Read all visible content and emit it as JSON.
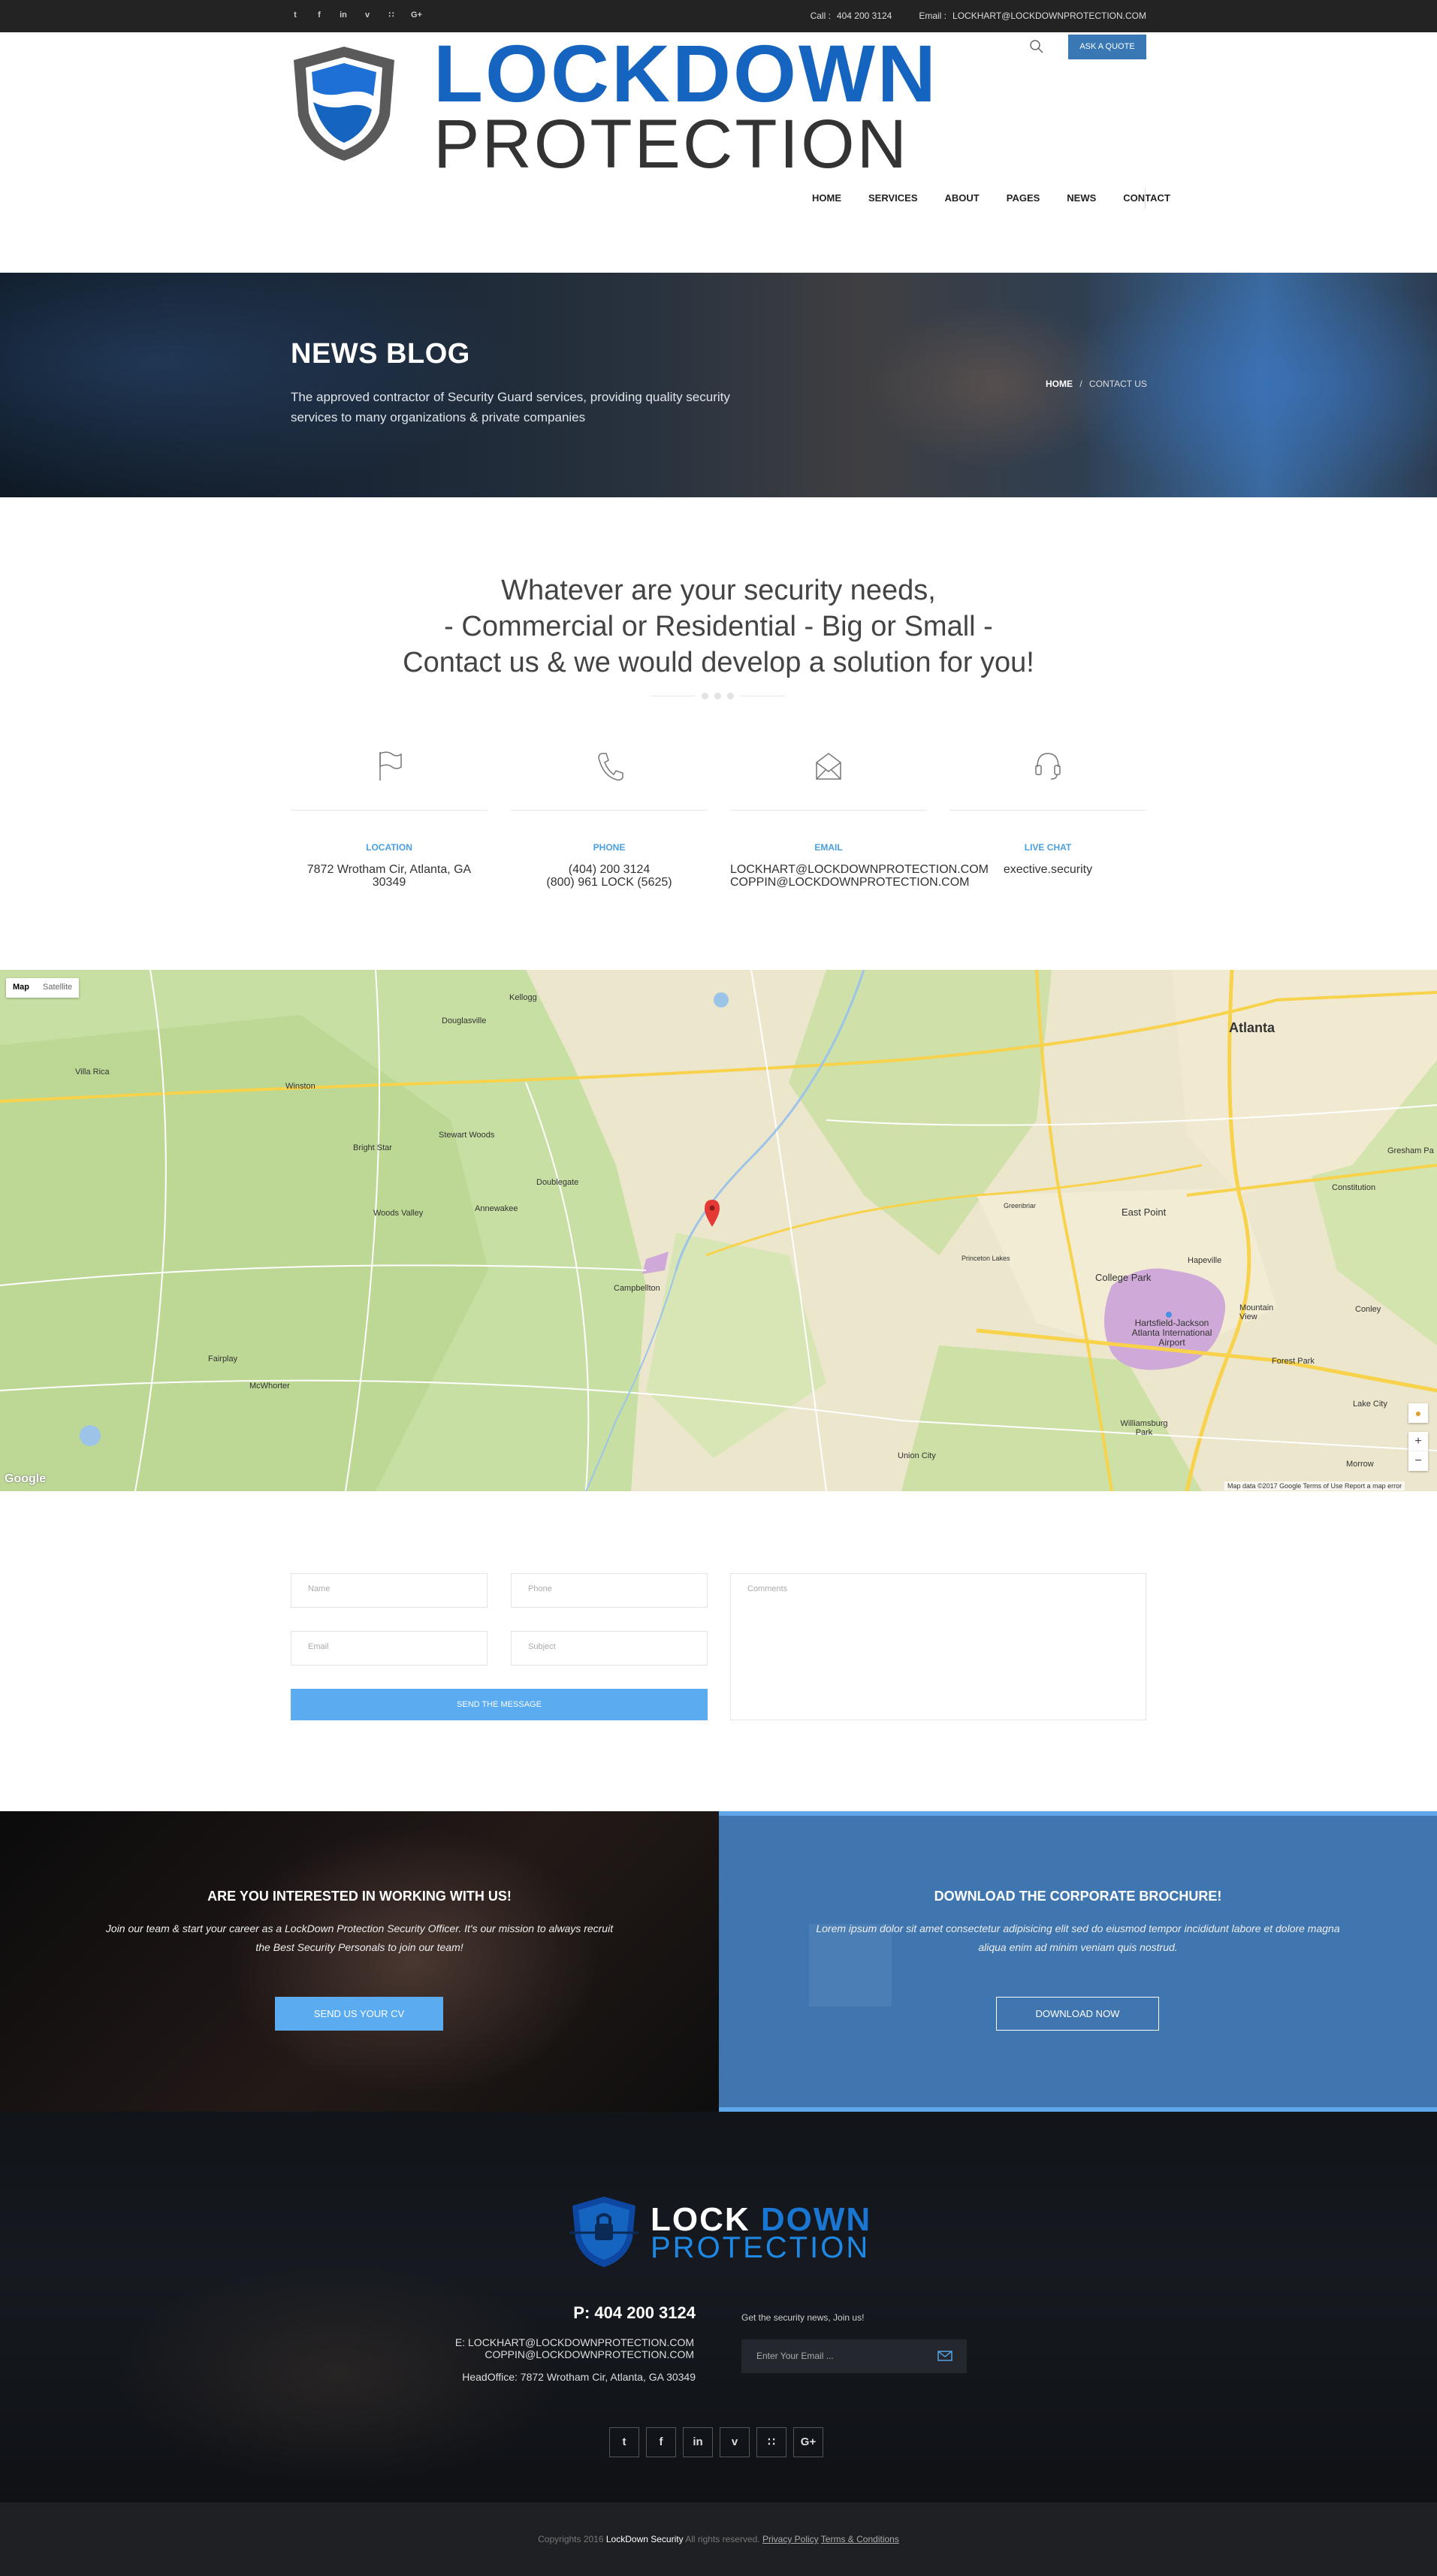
{
  "topbar": {
    "social_icons": [
      {
        "name": "twitter-icon",
        "glyph": "t"
      },
      {
        "name": "facebook-icon",
        "glyph": "f"
      },
      {
        "name": "linkedin-icon",
        "glyph": "in"
      },
      {
        "name": "vimeo-icon",
        "glyph": "v"
      },
      {
        "name": "rss-icon",
        "glyph": "∷"
      },
      {
        "name": "google-plus-icon",
        "glyph": "G+"
      }
    ],
    "call_label": "Call :",
    "call_value": "404 200 3124",
    "email_label": "Email :",
    "email_value": "LOCKHART@LOCKDOWNPROTECTION.COM"
  },
  "header": {
    "logo_line1": "LOCKDOWN",
    "logo_line2": "PROTECTION",
    "quote_button": "ASK A QUOTE",
    "nav": [
      "HOME",
      "SERVICES",
      "ABOUT",
      "PAGES",
      "NEWS",
      "CONTACT"
    ]
  },
  "hero": {
    "title": "NEWS BLOG",
    "subtitle": "The approved contractor of Security Guard services, providing quality security services to many organizations & private companies",
    "breadcrumb_home": "HOME",
    "breadcrumb_sep": "/",
    "breadcrumb_current": "CONTACT US"
  },
  "intro": {
    "line1": "Whatever are your security needs,",
    "line2": "- Commercial or Residential - Big or Small -",
    "line3": "Contact us & we would develop a solution for you!"
  },
  "info": [
    {
      "label": "LOCATION",
      "icon": "flag-icon",
      "lines": [
        "7872 Wrotham Cir, Atlanta, GA",
        "30349"
      ]
    },
    {
      "label": "PHONE",
      "icon": "phone-icon",
      "lines": [
        "(404) 200 3124",
        "(800) 961 LOCK (5625)"
      ]
    },
    {
      "label": "EMAIL",
      "icon": "envelope-icon",
      "lines": [
        "LOCKHART@LOCKDOWNPROTECTION.COM",
        "COPPIN@LOCKDOWNPROTECTION.COM"
      ]
    },
    {
      "label": "LIVE CHAT",
      "icon": "headset-icon",
      "lines": [
        "exective.security"
      ]
    }
  ],
  "map": {
    "btn_map": "Map",
    "btn_satellite": "Satellite",
    "labels": [
      "Atlanta",
      "Douglasville",
      "Kellogg",
      "Villa Rica",
      "Winston",
      "Bright Star",
      "Stewart Woods",
      "Doublegate",
      "Annewakee",
      "Woods Valley",
      "Campbellton",
      "Fairplay",
      "McWhorter",
      "East Point",
      "College Park",
      "Hapeville",
      "Hartsfield-Jackson Atlanta International Airport",
      "Mountain View",
      "Forest Park",
      "Conley",
      "Lake City",
      "Morrow",
      "Union City",
      "Williamsburg Park",
      "Gresham Pa",
      "Constitution",
      "Princeton Lakes",
      "Greenbriar"
    ],
    "google": "Google",
    "footer": "Map data ©2017 Google   Terms of Use   Report a map error",
    "zoom_in": "+",
    "zoom_out": "−"
  },
  "form": {
    "name_placeholder": "Name",
    "phone_placeholder": "Phone",
    "email_placeholder": "Email",
    "subject_placeholder": "Subject",
    "comments_placeholder": "Comments",
    "send_button": "SEND THE MESSAGE"
  },
  "cta_left": {
    "title": "ARE YOU INTERESTED IN WORKING WITH US!",
    "text": "Join our team & start your career as a LockDown Protection Security Officer. It's our mission to always recruit the Best Security Personals to join our team!",
    "button": "SEND US YOUR CV"
  },
  "cta_right": {
    "title": "DOWNLOAD THE CORPORATE BROCHURE!",
    "text": "Lorem ipsum dolor sit amet consectetur adipisicing elit sed do eiusmod tempor incididunt labore et dolore magna aliqua enim ad minim veniam quis nostrud.",
    "button": "DOWNLOAD NOW"
  },
  "footer": {
    "logo_lock": "LOCK",
    "logo_down": "DOWN",
    "logo_protection": "PROTECTION",
    "phone": "P: 404 200 3124",
    "email1": "E: LOCKHART@LOCKDOWNPROTECTION.COM",
    "email2": "COPPIN@LOCKDOWNPROTECTION.COM",
    "office": "HeadOffice: 7872 Wrotham Cir, Atlanta, GA 30349",
    "news_label": "Get the security news, Join us!",
    "news_placeholder": "Enter Your Email ...",
    "social_icons": [
      {
        "name": "twitter-icon",
        "glyph": "t"
      },
      {
        "name": "facebook-icon",
        "glyph": "f"
      },
      {
        "name": "linkedin-icon",
        "glyph": "in"
      },
      {
        "name": "vimeo-icon",
        "glyph": "v"
      },
      {
        "name": "rss-icon",
        "glyph": "∷"
      },
      {
        "name": "google-plus-icon",
        "glyph": "G+"
      }
    ]
  },
  "copyright": {
    "prefix": "Copyrights 2016",
    "brand": "LockDown Security",
    "rights": "All rights reserved.",
    "privacy": "Privacy Policy",
    "terms": "Terms & Conditions"
  },
  "colors": {
    "accent_blue": "#5aabf0",
    "brand_blue": "#1565c0",
    "panel_blue": "#3f76b0",
    "topbar": "#232323"
  }
}
